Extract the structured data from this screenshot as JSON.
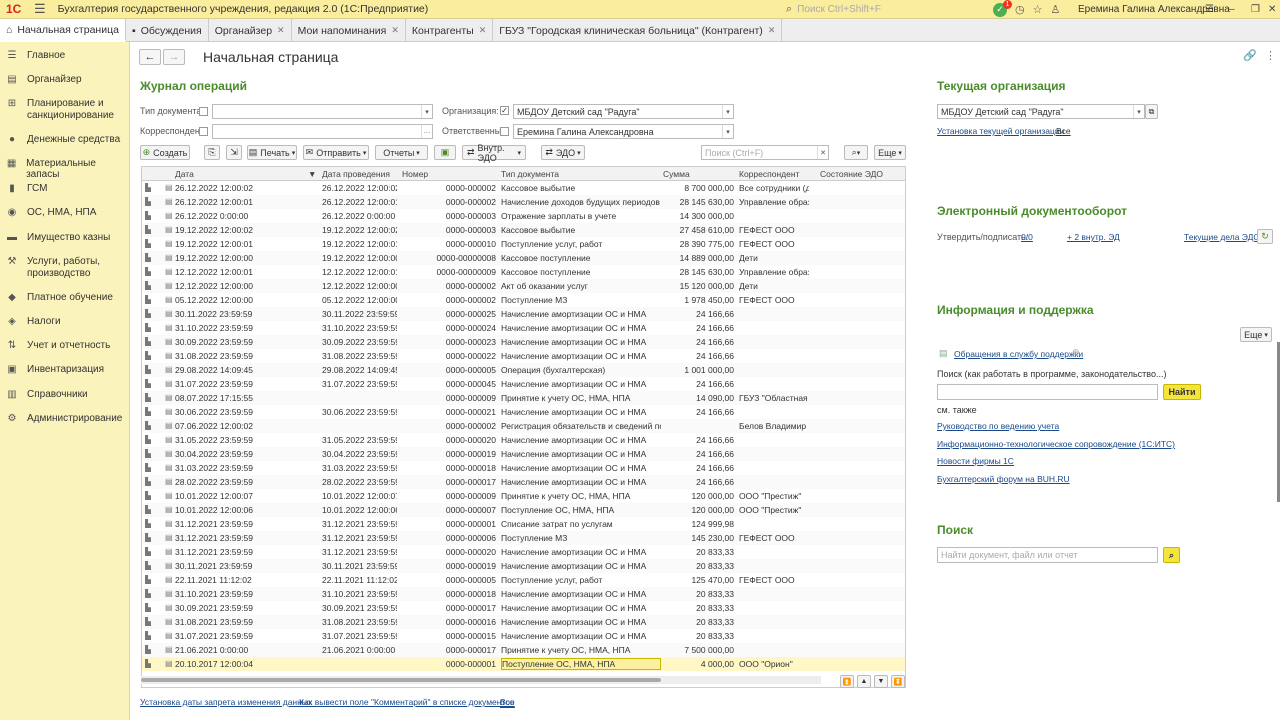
{
  "app": {
    "logo": "1С",
    "title": "Бухгалтерия государственного учреждения, редакция 2.0  (1С:Предприятие)",
    "search_placeholder": "Поиск Ctrl+Shift+F",
    "notif_count": "1",
    "user": "Еремина Галина Александровна"
  },
  "tabs": [
    {
      "label": "Начальная страница",
      "closable": false
    },
    {
      "label": "Обсуждения",
      "closable": false
    },
    {
      "label": "Органайзер",
      "closable": true
    },
    {
      "label": "Мои напоминания",
      "closable": true
    },
    {
      "label": "Контрагенты",
      "closable": true
    },
    {
      "label": "ГБУЗ \"Городская клиническая больница\" (Контрагент)",
      "closable": true
    }
  ],
  "sidebar": {
    "items": [
      {
        "label": "Главное",
        "icon": "list-icon"
      },
      {
        "label": "Органайзер",
        "icon": "organizer-icon"
      },
      {
        "label": "Планирование и санкционирование",
        "icon": "planning-icon"
      },
      {
        "label": "Денежные средства",
        "icon": "money-icon"
      },
      {
        "label": "Материальные запасы",
        "icon": "stock-icon"
      },
      {
        "label": "ГСМ",
        "icon": "fuel-icon"
      },
      {
        "label": "ОС, НМА, НПА",
        "icon": "assets-icon"
      },
      {
        "label": "Имущество казны",
        "icon": "treasury-icon"
      },
      {
        "label": "Услуги, работы, производство",
        "icon": "services-icon"
      },
      {
        "label": "Платное обучение",
        "icon": "education-icon"
      },
      {
        "label": "Налоги",
        "icon": "taxes-icon"
      },
      {
        "label": "Учет и отчетность",
        "icon": "reports-icon"
      },
      {
        "label": "Инвентаризация",
        "icon": "inventory-icon"
      },
      {
        "label": "Справочники",
        "icon": "catalog-icon"
      },
      {
        "label": "Администрирование",
        "icon": "gear-icon"
      }
    ]
  },
  "page": {
    "title": "Начальная страница"
  },
  "journal": {
    "heading": "Журнал операций",
    "doctype_label": "Тип документа:",
    "org_label": "Организация:",
    "org_value": "МБДОУ Детский сад \"Радуга\"",
    "correspondent_label": "Корреспондент:",
    "responsible_label": "Ответственный:",
    "responsible_value": "Еремина Галина Александровна",
    "toolbar": {
      "create": "Создать",
      "print": "Печать",
      "send": "Отправить",
      "reports": "Отчеты",
      "internal_edo": "Внутр. ЭДО",
      "edo": "ЭДО",
      "search_placeholder": "Поиск (Ctrl+F)",
      "more": "Еще"
    },
    "columns": [
      "Дата",
      "Дата проведения",
      "Номер",
      "Тип документа",
      "Сумма",
      "Корреспондент",
      "Состояние ЭДО"
    ],
    "rows": [
      [
        "26.12.2022 12:00:02",
        "26.12.2022 12:00:02",
        "0000-000002",
        "Кассовое выбытие",
        "8 700 000,00",
        "Все сотрудники (дл..."
      ],
      [
        "26.12.2022 12:00:01",
        "26.12.2022 12:00:01",
        "0000-000002",
        "Начисление доходов будущих периодов",
        "28 145 630,00",
        "Управление образо..."
      ],
      [
        "26.12.2022 0:00:00",
        "26.12.2022 0:00:00",
        "0000-000003",
        "Отражение зарплаты в учете",
        "14 300 000,00",
        ""
      ],
      [
        "19.12.2022 12:00:02",
        "19.12.2022 12:00:02",
        "0000-000003",
        "Кассовое выбытие",
        "27 458 610,00",
        "ГЕФЕСТ ООО"
      ],
      [
        "19.12.2022 12:00:01",
        "19.12.2022 12:00:01",
        "0000-000010",
        "Поступление услуг, работ",
        "28 390 775,00",
        "ГЕФЕСТ ООО"
      ],
      [
        "19.12.2022 12:00:00",
        "19.12.2022 12:00:00",
        "0000-00000008",
        "Кассовое поступление",
        "14 889 000,00",
        "Дети"
      ],
      [
        "12.12.2022 12:00:01",
        "12.12.2022 12:00:01",
        "0000-00000009",
        "Кассовое поступление",
        "28 145 630,00",
        "Управление образо..."
      ],
      [
        "12.12.2022 12:00:00",
        "12.12.2022 12:00:00",
        "0000-000002",
        "Акт об оказании услуг",
        "15 120 000,00",
        "Дети"
      ],
      [
        "05.12.2022 12:00:00",
        "05.12.2022 12:00:00",
        "0000-000002",
        "Поступление МЗ",
        "1 978 450,00",
        "ГЕФЕСТ ООО"
      ],
      [
        "30.11.2022 23:59:59",
        "30.11.2022 23:59:59",
        "0000-000025",
        "Начисление амортизации ОС и НМА",
        "24 166,66",
        ""
      ],
      [
        "31.10.2022 23:59:59",
        "31.10.2022 23:59:59",
        "0000-000024",
        "Начисление амортизации ОС и НМА",
        "24 166,66",
        ""
      ],
      [
        "30.09.2022 23:59:59",
        "30.09.2022 23:59:59",
        "0000-000023",
        "Начисление амортизации ОС и НМА",
        "24 166,66",
        ""
      ],
      [
        "31.08.2022 23:59:59",
        "31.08.2022 23:59:59",
        "0000-000022",
        "Начисление амортизации ОС и НМА",
        "24 166,66",
        ""
      ],
      [
        "29.08.2022 14:09:45",
        "29.08.2022 14:09:45",
        "0000-000005",
        "Операция (бухгалтерская)",
        "1 001 000,00",
        ""
      ],
      [
        "31.07.2022 23:59:59",
        "31.07.2022 23:59:59",
        "0000-000045",
        "Начисление амортизации ОС и НМА",
        "24 166,66",
        ""
      ],
      [
        "08.07.2022 17:15:55",
        "",
        "0000-000009",
        "Принятие к учету ОС, НМА, НПА",
        "14 090,00",
        "ГБУЗ \"Областная б..."
      ],
      [
        "30.06.2022 23:59:59",
        "30.06.2022 23:59:59",
        "0000-000021",
        "Начисление амортизации ОС и НМА",
        "24 166,66",
        ""
      ],
      [
        "07.06.2022 12:00:02",
        "",
        "0000-000002",
        "Регистрация обязательств и сведений по ...",
        "",
        "Белов Владимир Н..."
      ],
      [
        "31.05.2022 23:59:59",
        "31.05.2022 23:59:59",
        "0000-000020",
        "Начисление амортизации ОС и НМА",
        "24 166,66",
        ""
      ],
      [
        "30.04.2022 23:59:59",
        "30.04.2022 23:59:59",
        "0000-000019",
        "Начисление амортизации ОС и НМА",
        "24 166,66",
        ""
      ],
      [
        "31.03.2022 23:59:59",
        "31.03.2022 23:59:59",
        "0000-000018",
        "Начисление амортизации ОС и НМА",
        "24 166,66",
        ""
      ],
      [
        "28.02.2022 23:59:59",
        "28.02.2022 23:59:59",
        "0000-000017",
        "Начисление амортизации ОС и НМА",
        "24 166,66",
        ""
      ],
      [
        "10.01.2022 12:00:07",
        "10.01.2022 12:00:07",
        "0000-000009",
        "Принятие к учету ОС, НМА, НПА",
        "120 000,00",
        "ООО \"Престиж\""
      ],
      [
        "10.01.2022 12:00:06",
        "10.01.2022 12:00:06",
        "0000-000007",
        "Поступление ОС, НМА, НПА",
        "120 000,00",
        "ООО \"Престиж\""
      ],
      [
        "31.12.2021 23:59:59",
        "31.12.2021 23:59:59",
        "0000-000001",
        "Списание затрат по услугам",
        "124 999,98",
        ""
      ],
      [
        "31.12.2021 23:59:59",
        "31.12.2021 23:59:59",
        "0000-000006",
        "Поступление МЗ",
        "145 230,00",
        "ГЕФЕСТ ООО"
      ],
      [
        "31.12.2021 23:59:59",
        "31.12.2021 23:59:59",
        "0000-000020",
        "Начисление амортизации ОС и НМА",
        "20 833,33",
        ""
      ],
      [
        "30.11.2021 23:59:59",
        "30.11.2021 23:59:59",
        "0000-000019",
        "Начисление амортизации ОС и НМА",
        "20 833,33",
        ""
      ],
      [
        "22.11.2021 11:12:02",
        "22.11.2021 11:12:02",
        "0000-000005",
        "Поступление услуг, работ",
        "125 470,00",
        "ГЕФЕСТ ООО"
      ],
      [
        "31.10.2021 23:59:59",
        "31.10.2021 23:59:59",
        "0000-000018",
        "Начисление амортизации ОС и НМА",
        "20 833,33",
        ""
      ],
      [
        "30.09.2021 23:59:59",
        "30.09.2021 23:59:59",
        "0000-000017",
        "Начисление амортизации ОС и НМА",
        "20 833,33",
        ""
      ],
      [
        "31.08.2021 23:59:59",
        "31.08.2021 23:59:59",
        "0000-000016",
        "Начисление амортизации ОС и НМА",
        "20 833,33",
        ""
      ],
      [
        "31.07.2021 23:59:59",
        "31.07.2021 23:59:59",
        "0000-000015",
        "Начисление амортизации ОС и НМА",
        "20 833,33",
        ""
      ],
      [
        "21.06.2021 0:00:00",
        "21.06.2021 0:00:00",
        "0000-000017",
        "Принятие к учету ОС, НМА, НПА",
        "7 500 000,00",
        ""
      ],
      [
        "20.10.2017 12:00:04",
        "",
        "0000-000001",
        "Поступление ОС, НМА, НПА",
        "4 000,00",
        "ООО \"Орион\""
      ]
    ],
    "footer_links": [
      "Установка даты запрета изменения данных",
      "Как вывести поле \"Комментарий\" в списке документов",
      "Все"
    ]
  },
  "org_panel": {
    "heading": "Текущая организация",
    "value": "МБДОУ Детский сад \"Радуга\"",
    "link": "Установка текущей организации",
    "all": "Все"
  },
  "edo_panel": {
    "heading": "Электронный документооборот",
    "approve_label": "Утвердить/подписать:",
    "approve_value": "0/0",
    "internal": "+ 2 внутр. ЭД",
    "current": "Текущие дела ЭДО"
  },
  "info_panel": {
    "heading": "Информация и поддержка",
    "more": "Еще",
    "support_link": "Обращения в службу поддержки",
    "search_label": "Поиск (как работать в программе, законодательство...)",
    "find": "Найти",
    "see_also": "см. также",
    "links": [
      "Руководство по ведению учета",
      "Информационно-технологическое сопровождение (1С:ИТС)",
      "Новости фирмы 1С",
      "Бухгалтерский форум на BUH.RU"
    ]
  },
  "search_panel": {
    "heading": "Поиск",
    "placeholder": "Найти документ, файл или отчет"
  },
  "colors": {
    "accent_green": "#4a8c2b",
    "sidebar": "#fbf3bc",
    "topbar": "#fbed9e",
    "link": "#1a4a8a",
    "selected_row": "#fff7c6"
  }
}
